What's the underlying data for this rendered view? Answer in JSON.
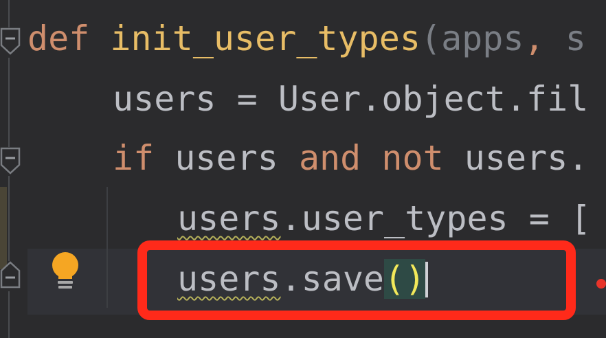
{
  "editor": {
    "line1": {
      "kw_def": "def",
      "fn_name": "init_user_types",
      "open_paren": "(",
      "param1": "apps",
      "sep": ", ",
      "param2_partial": "s"
    },
    "line2": {
      "var": "users",
      "eq": " = ",
      "call": "User.object.fil"
    },
    "line3": {
      "kw_if": "if",
      "var1": "users",
      "kw_and": "and",
      "kw_not": "not",
      "var2": "users."
    },
    "line4": {
      "var": "users",
      "rest": ".user_types = ["
    },
    "line5": {
      "var": "users",
      "method": ".save",
      "parens": "()"
    }
  },
  "icons": {
    "fold": "fold-marker-icon",
    "intention": "lightbulb-icon"
  },
  "colors": {
    "keyword": "#cf8e6d",
    "function": "#e8bd66",
    "parameter": "#7a7e85",
    "identifier": "#bcbec4",
    "highlight_box": "#ff2a1a",
    "bulb": "#f5a623"
  }
}
